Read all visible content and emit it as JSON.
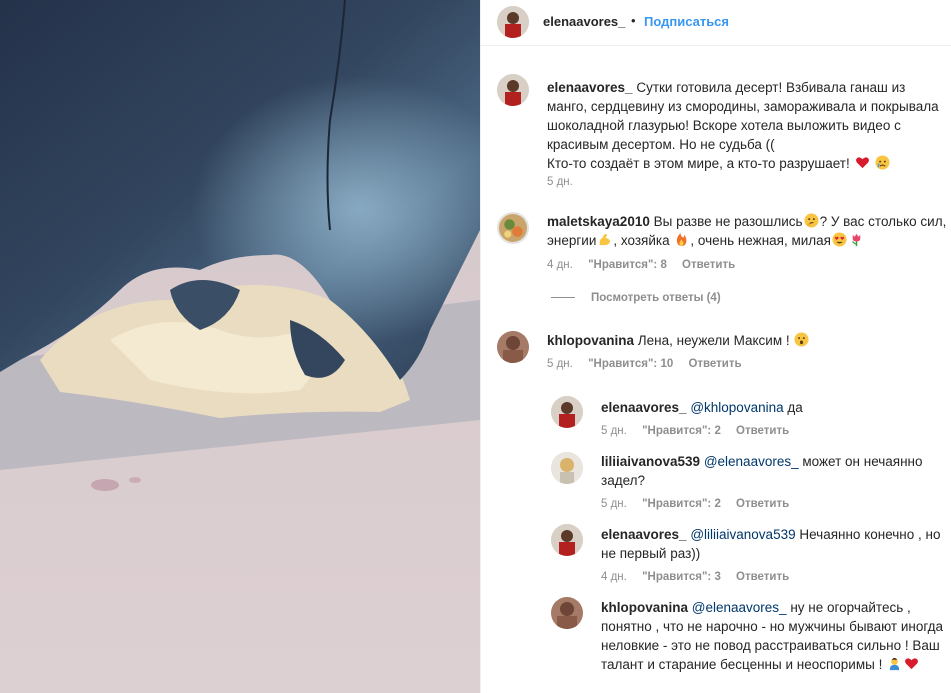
{
  "header": {
    "username": "elenaavores_",
    "separator": "•",
    "follow_label": "Подписаться"
  },
  "caption": {
    "username": "elenaavores_",
    "text": "Сутки готовила десерт! Взбивала ганаш из манго, сердцевину из смородины, замораживала и покрывала шоколадной глазурью! Вскоре хотела выложить видео с красивым десертом. Но не судьба ((",
    "text2": "Кто-то создаёт в этом мире, а кто-то разрушает!",
    "emoji": [
      "heart",
      "crying-face"
    ],
    "time": "5 дн."
  },
  "comments": [
    {
      "username": "maletskaya2010",
      "text_a": "Вы разве не разошлись",
      "text_b": "? У вас столько сил, энергии",
      "text_c": ", хозяйка",
      "text_d": ", очень нежная, милая",
      "emoji": [
        "thinking-face",
        "flexed-biceps",
        "fire",
        "heart-eyes",
        "tulip"
      ],
      "time": "4 дн.",
      "likes": "\"Нравится\": 8",
      "reply": "Ответить",
      "view_replies": "Посмотреть ответы (4)"
    },
    {
      "username": "khlopovanina",
      "text": "Лена, неужели Максим !",
      "emoji": [
        "surprised-face"
      ],
      "time": "5 дн.",
      "likes": "\"Нравится\": 10",
      "reply": "Ответить",
      "replies": [
        {
          "username": "elenaavores_",
          "mention": "@khlopovanina",
          "text": "да",
          "time": "5 дн.",
          "likes": "\"Нравится\": 2",
          "reply": "Ответить"
        },
        {
          "username": "liliiaivanova539",
          "mention": "@elenaavores_",
          "text": "может он нечаянно задел?",
          "time": "5 дн.",
          "likes": "\"Нравится\": 2",
          "reply": "Ответить"
        },
        {
          "username": "elenaavores_",
          "mention": "@liliiaivanova539",
          "text": "Нечаянно конечно , но не первый раз))",
          "time": "4 дн.",
          "likes": "\"Нравится\": 3",
          "reply": "Ответить"
        },
        {
          "username": "khlopovanina",
          "mention": "@elenaavores_",
          "text": "ну не огорчайтесь , понятно , что не нарочно - но мужчины бывают иногда неловкие - это не повод расстраиваться сильно ! Ваш талант и старание бесценны и неоспоримы !",
          "emoji": [
            "person-bowing",
            "heart"
          ]
        }
      ]
    }
  ],
  "colors": {
    "link_blue": "#3897f0",
    "mention_blue": "#00376b",
    "meta_gray": "#8e8e8e",
    "text": "#262626"
  }
}
